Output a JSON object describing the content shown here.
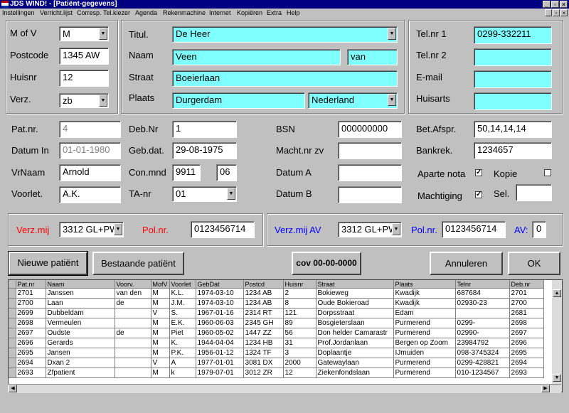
{
  "window": {
    "title": "JDS WIND! - [Patiënt-gegevens]",
    "controls": [
      "_",
      "▫",
      "×"
    ]
  },
  "menu": [
    "Instellingen",
    "Verricht.lijst",
    "Corresp.",
    "Tel.kiezer",
    "Agenda",
    "Rekenmachine",
    "Internet",
    "Kopiëren",
    "Extra",
    "Help"
  ],
  "patient": {
    "mofv_label": "M of V",
    "mofv": "M",
    "postcode_label": "Postcode",
    "postcode": "1345 AW",
    "huisnr_label": "Huisnr",
    "huisnr": "12",
    "verz_label": "Verz.",
    "verz": "zb",
    "titul_label": "Titul.",
    "titul": "De Heer",
    "naam_label": "Naam",
    "naam": "Veen",
    "tussenvoegsel": "van",
    "straat_label": "Straat",
    "straat": "Boeierlaan",
    "plaats_label": "Plaats",
    "plaats": "Durgerdam",
    "land": "Nederland",
    "telnr1_label": "Tel.nr 1",
    "telnr1": "0299-332211",
    "telnr2_label": "Tel.nr 2",
    "telnr2": "",
    "email_label": "E-mail",
    "email": "",
    "huisarts_label": "Huisarts",
    "huisarts": "",
    "patnr_label": "Pat.nr.",
    "patnr": "4",
    "datumin_label": "Datum In",
    "datumin": "01-01-1980",
    "vrnaam_label": "VrNaam",
    "vrnaam": "Arnold",
    "voorlet_label": "Voorlet.",
    "voorlet": "A.K.",
    "debnr_label": "Deb.Nr",
    "debnr": "1",
    "gebdat_label": "Geb.dat.",
    "gebdat": "29-08-1975",
    "conmnd_label": "Con.mnd",
    "conmnd1": "9911",
    "conmnd2": "06",
    "tanr_label": "TA-nr",
    "tanr": "01",
    "bsn_label": "BSN",
    "bsn": "000000000",
    "machtnr_label": "Macht.nr zv",
    "machtnr": "",
    "datuma_label": "Datum A",
    "datuma": "",
    "datumb_label": "Datum B",
    "datumb": "",
    "betafspr_label": "Bet.Afspr.",
    "betafspr": "50,14,14,14",
    "bankrek_label": "Bankrek.",
    "bankrek": "1234657",
    "apartenota_label": "Aparte nota",
    "apartenota": "✓",
    "kopie_label": "Kopie",
    "kopie": "",
    "machtiging_label": "Machtiging",
    "machtiging": "✓",
    "sel_label": "Sel.",
    "sel": ""
  },
  "insurance": {
    "verzmij_label": "Verz.mij",
    "verzmij": "3312 GL+PW",
    "polnr_label": "Pol.nr.",
    "polnr": "0123456714",
    "verzmijav_label": "Verz.mij AV",
    "verzmijav": "3312 GL+PW",
    "polnr2_label": "Pol.nr.",
    "polnr2": "0123456714",
    "av_label": "AV:",
    "av": "0",
    "colors": {
      "verzmij": "#ff0000",
      "verzmijav": "#0000ff"
    }
  },
  "buttons": {
    "nieuwe": "Nieuwe patiënt",
    "bestaande": "Bestaande patiënt",
    "cov": "cov 00-00-0000",
    "annuleren": "Annuleren",
    "ok": "OK"
  },
  "table": {
    "columns": [
      "Pat.nr",
      "Naam",
      "Voorv.",
      "MofV",
      "Voorlet",
      "GebDat",
      "Postcd",
      "Huisnr",
      "Straat",
      "Plaats",
      "Telnr",
      "Deb.nr"
    ],
    "rows": [
      [
        "2701",
        "Janssen",
        "van den",
        "M",
        "K.L.",
        "1974-03-10",
        "1234 AB",
        "2",
        "Bokieweg",
        "Kwadijk",
        "687684",
        "2701"
      ],
      [
        "2700",
        "Laan",
        "de",
        "M",
        "J.M.",
        "1974-03-10",
        "1234 AB",
        "8",
        "Oude Bokieroad",
        "Kwadijk",
        "02930-23",
        "2700"
      ],
      [
        "2699",
        "Dubbeldam",
        "",
        "V",
        "S.",
        "1967-01-16",
        "2314 RT",
        "121",
        "Dorpsstraat",
        "Edam",
        "",
        "2681"
      ],
      [
        "2698",
        "Vermeulen",
        "",
        "M",
        "E.K.",
        "1960-06-03",
        "2345 GH",
        "89",
        "Bosgieterslaan",
        "Purmerend",
        "0299-",
        "2698"
      ],
      [
        "2697",
        "Oudste",
        "de",
        "M",
        "Piet",
        "1960-05-02",
        "1447 ZZ",
        "56",
        "Don helder Camarastr",
        "Purmerend",
        "02990-",
        "2697"
      ],
      [
        "2696",
        "Gerards",
        "",
        "M",
        "K.",
        "1944-04-04",
        "1234 HB",
        "31",
        "Prof.Jordanlaan",
        "Bergen op Zoom",
        "23984792",
        "2696"
      ],
      [
        "2695",
        "Jansen",
        "",
        "M",
        "P.K.",
        "1956-01-12",
        "1324 TF",
        "3",
        "Doplaantje",
        "IJmuiden",
        "098-3745324",
        "2695"
      ],
      [
        "2694",
        "Dxan 2",
        "",
        "V",
        "A",
        "1977-01-01",
        "3081 DX",
        "2000",
        "Gatewaylaan",
        "Purmerend",
        "0299-428821",
        "2694"
      ],
      [
        "2693",
        "Zfpatient",
        "",
        "M",
        "k",
        "1979-07-01",
        "3012 ZR",
        "12",
        "Ziekenfondslaan",
        "Purmerend",
        "010-1234567",
        "2693"
      ]
    ]
  }
}
